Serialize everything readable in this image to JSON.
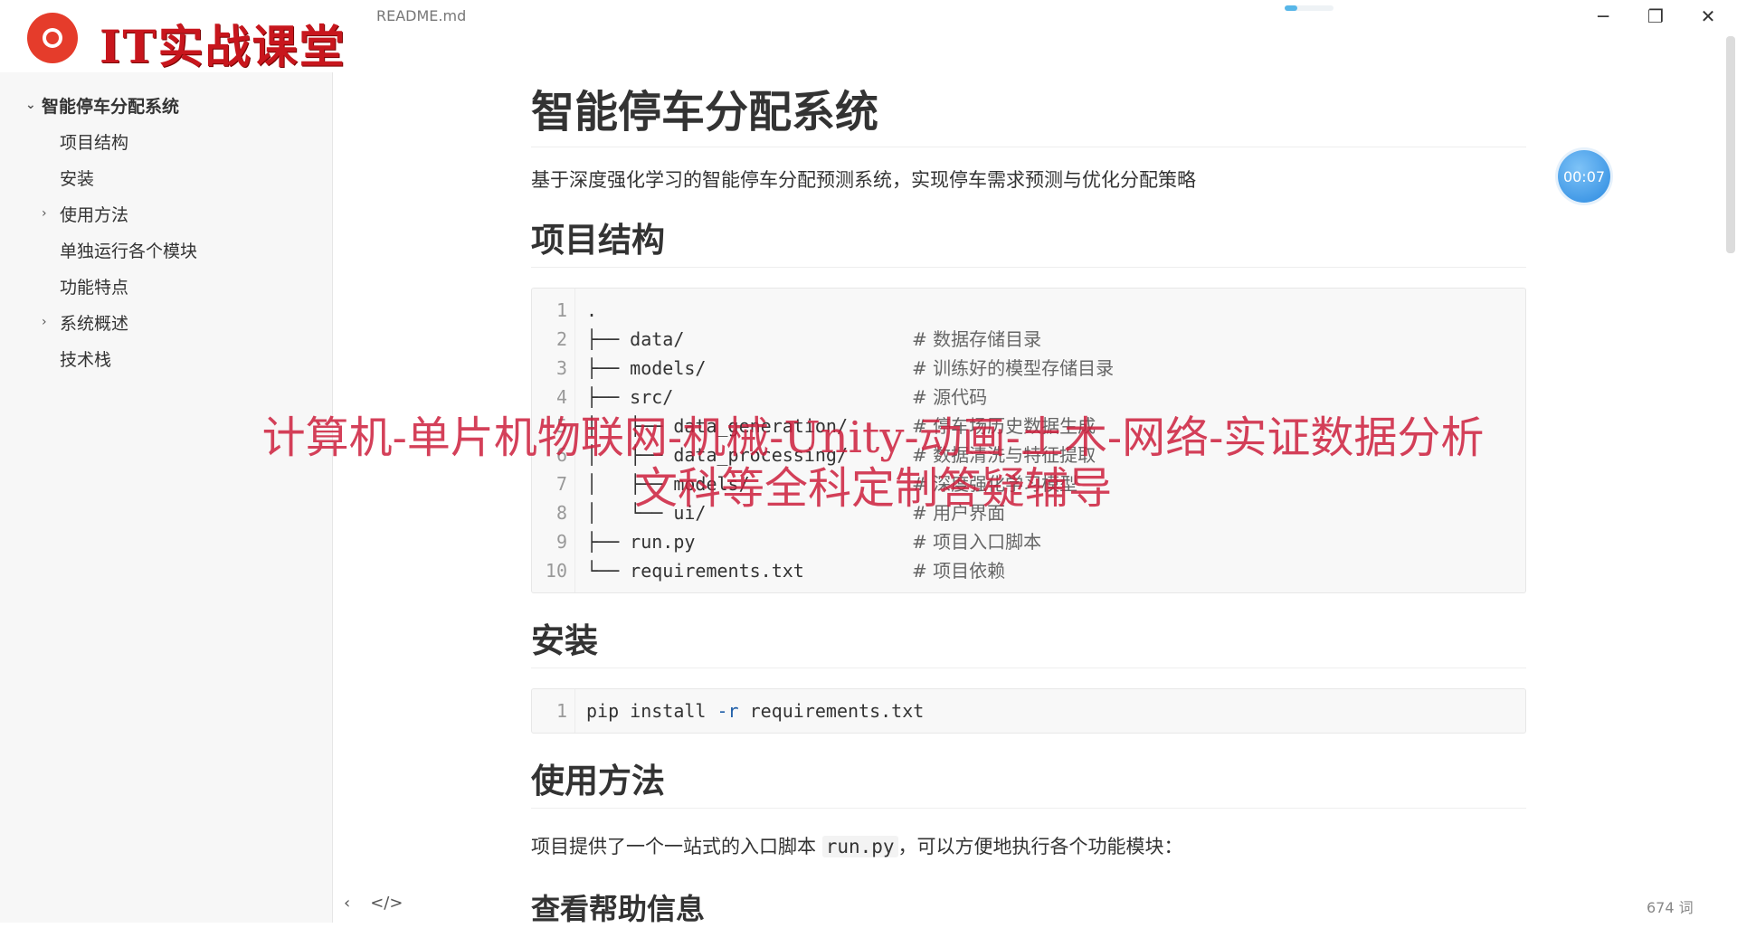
{
  "logo": {
    "text": "IT实战课堂"
  },
  "titlebar": {
    "filename": "README.md",
    "progress": 0.25,
    "minimize": "─",
    "maximize": "❐",
    "close": "✕"
  },
  "sidebar": {
    "items": [
      {
        "label": "智能停车分配系统",
        "level": 1,
        "arrow": "⌄"
      },
      {
        "label": "项目结构",
        "level": 2,
        "arrow": ""
      },
      {
        "label": "安装",
        "level": 2,
        "arrow": ""
      },
      {
        "label": "使用方法",
        "level": 2,
        "arrow": "›"
      },
      {
        "label": "单独运行各个模块",
        "level": 2,
        "arrow": ""
      },
      {
        "label": "功能特点",
        "level": 2,
        "arrow": ""
      },
      {
        "label": "系统概述",
        "level": 2,
        "arrow": "›"
      },
      {
        "label": "技术栈",
        "level": 2,
        "arrow": ""
      }
    ]
  },
  "doc": {
    "title": "智能停车分配系统",
    "description": "基于深度强化学习的智能停车分配预测系统，实现停车需求预测与优化分配策略",
    "structure_heading": "项目结构",
    "structure_lines": [
      {
        "num": "1",
        "code": ".",
        "comment": ""
      },
      {
        "num": "2",
        "code": "├── data/",
        "comment": "# 数据存储目录"
      },
      {
        "num": "3",
        "code": "├── models/",
        "comment": "# 训练好的模型存储目录"
      },
      {
        "num": "4",
        "code": "├── src/",
        "comment": "# 源代码"
      },
      {
        "num": "5",
        "code": "│   ├── data_generation/",
        "comment": "# 停车场历史数据生成"
      },
      {
        "num": "6",
        "code": "│   ├── data_processing/",
        "comment": "# 数据清洗与特征提取"
      },
      {
        "num": "7",
        "code": "│   ├── models/",
        "comment": "# 深度强化学习模型"
      },
      {
        "num": "8",
        "code": "│   └── ui/",
        "comment": "# 用户界面"
      },
      {
        "num": "9",
        "code": "├── run.py",
        "comment": "# 项目入口脚本"
      },
      {
        "num": "10",
        "code": "└── requirements.txt",
        "comment": "# 项目依赖"
      }
    ],
    "install_heading": "安装",
    "install_line_num": "1",
    "install_cmd_a": "pip install ",
    "install_cmd_flag": "-r",
    "install_cmd_b": " requirements.txt",
    "usage_heading": "使用方法",
    "usage_text_a": "项目提供了一个一站式的入口脚本 ",
    "usage_code": "run.py",
    "usage_text_b": "，可以方便地执行各个功能模块：",
    "help_heading": "查看帮助信息"
  },
  "timer": {
    "text": "00:07"
  },
  "watermark": {
    "line1": "计算机-单片机物联网-机械-Unity-动画-土木-网络-实证数据分析",
    "line2": "文科等全科定制答疑辅导"
  },
  "bottombar": {
    "back": "‹",
    "source": "</>",
    "word_count": "674 词"
  },
  "colors": {
    "accent": "#57b6e8",
    "watermark": "#cc1e3c",
    "logo_red": "#c8161d"
  }
}
